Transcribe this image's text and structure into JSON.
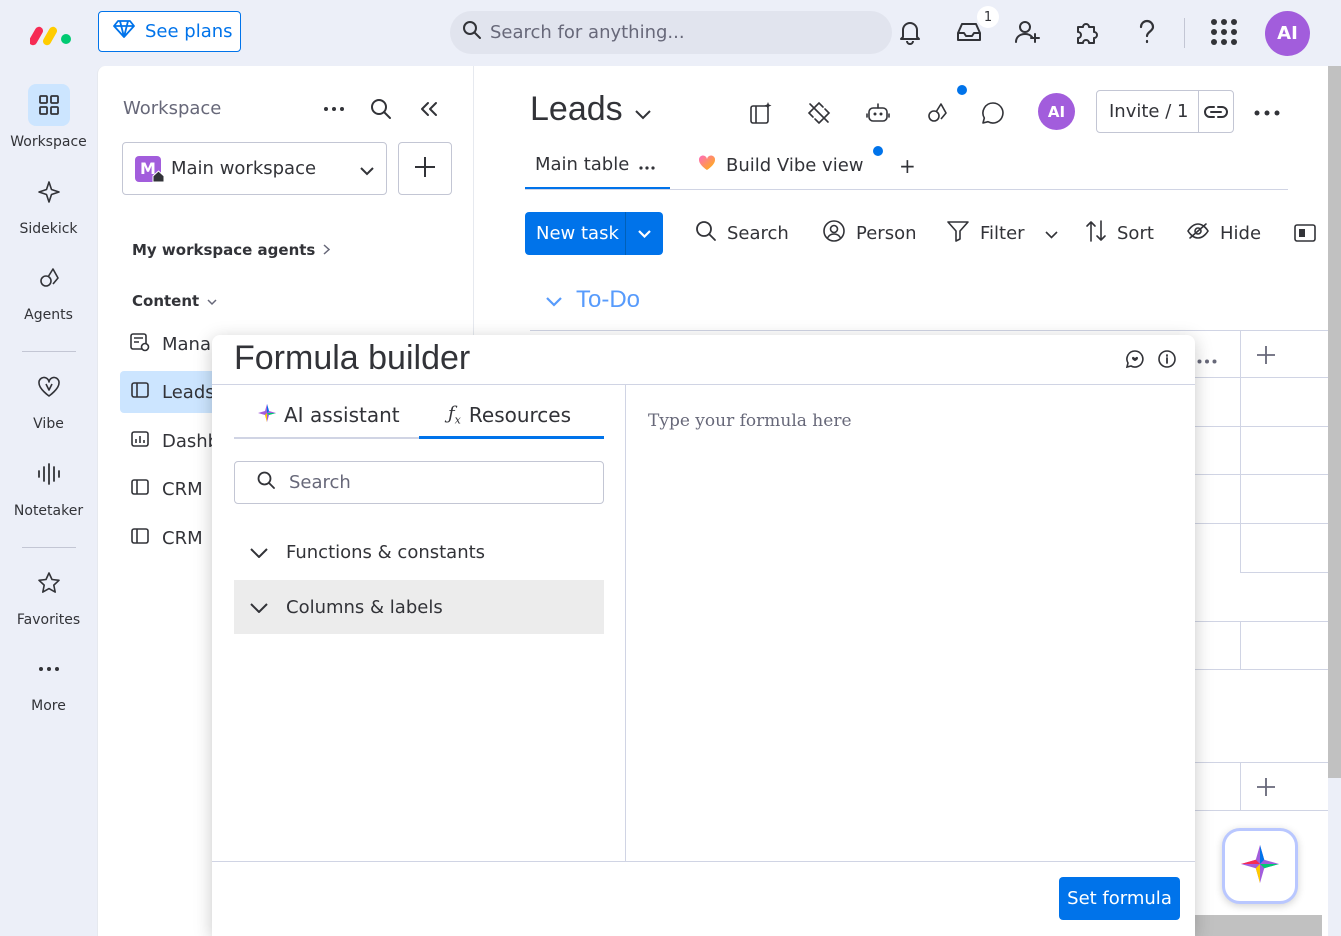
{
  "topbar": {
    "see_plans": "See plans",
    "search_placeholder": "Search for anything...",
    "inbox_badge": "1",
    "user_initials": "AI"
  },
  "rail": {
    "items": [
      {
        "label": "Workspace"
      },
      {
        "label": "Sidekick"
      },
      {
        "label": "Agents"
      },
      {
        "label": "Vibe"
      },
      {
        "label": "Notetaker"
      },
      {
        "label": "Favorites"
      },
      {
        "label": "More"
      }
    ]
  },
  "workspace": {
    "title": "Workspace",
    "selected": "Main workspace",
    "selected_initial": "M",
    "agents_link": "My workspace agents",
    "content_label": "Content",
    "items": [
      {
        "label": "Manag"
      },
      {
        "label": "Leads"
      },
      {
        "label": "Dashb"
      },
      {
        "label": "CRM"
      },
      {
        "label": "CRM"
      }
    ]
  },
  "board": {
    "title": "Leads",
    "user_initials": "AI",
    "invite_label": "Invite / 1",
    "tabs": [
      {
        "label": "Main table"
      },
      {
        "label": "Build Vibe view"
      }
    ],
    "add_view": "+",
    "new_task": "New task",
    "toolbar": {
      "search": "Search",
      "person": "Person",
      "filter": "Filter",
      "sort": "Sort",
      "hide": "Hide"
    },
    "group_title": "To-Do"
  },
  "formula_builder": {
    "title": "Formula builder",
    "tab_ai": "AI assistant",
    "tab_resources": "Resources",
    "search_placeholder": "Search",
    "sections": [
      {
        "label": "Functions & constants"
      },
      {
        "label": "Columns & labels"
      }
    ],
    "formula_placeholder": "Type your formula here",
    "set_formula": "Set formula"
  },
  "colors": {
    "primary": "#0073ea",
    "accent_purple": "#a25ddc",
    "selected_bg": "#cce5ff",
    "group_blue": "#579bfc"
  }
}
